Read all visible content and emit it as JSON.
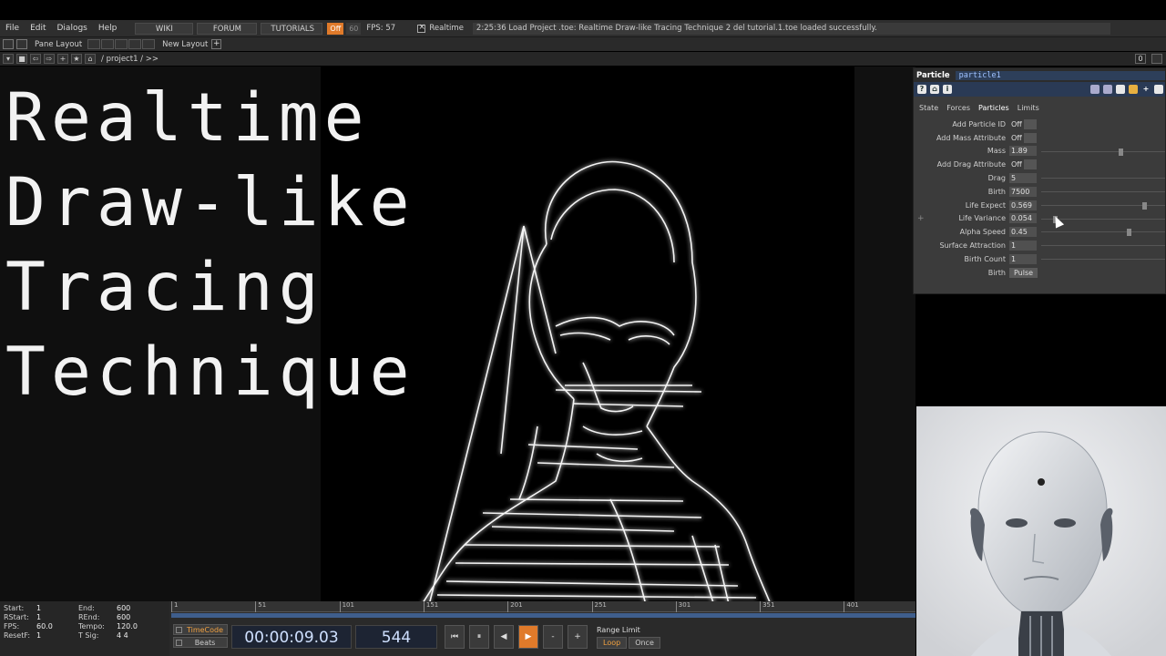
{
  "menu": {
    "items": [
      "File",
      "Edit",
      "Dialogs",
      "Help"
    ],
    "wiki": "WIKI",
    "forum": "FORUM",
    "tutorials": "TUTORIALS",
    "realtime_on": "Off",
    "realtime_rate": "60",
    "fps": "FPS:  57",
    "realtime_label": "Realtime",
    "status": "2:25:36 Load Project .toe: Realtime Draw-like Tracing Technique 2 del tutorial.1.toe loaded successfully."
  },
  "layout_bar": {
    "pane_layout": "Pane Layout",
    "new_layout": "New Layout",
    "plus": "+"
  },
  "path_bar": {
    "path": "/ project1 / >>",
    "right_value": "0"
  },
  "title": {
    "line1": "Realtime",
    "line2": "Draw-like",
    "line3": "Tracing",
    "line4": "Technique"
  },
  "params": {
    "type": "Particle",
    "name": "particle1",
    "toolbar": [
      "?",
      "⌂",
      "i"
    ],
    "tabs": [
      "State",
      "Forces",
      "Particles",
      "Limits"
    ],
    "active_tab": "Particles",
    "rows": [
      {
        "label": "Add Particle ID",
        "value": "Off",
        "kind": "toggle"
      },
      {
        "label": "Add Mass Attribute",
        "value": "Off",
        "kind": "toggle"
      },
      {
        "label": "Mass",
        "value": "1.89",
        "kind": "slider",
        "level": 0.65
      },
      {
        "label": "Add Drag Attribute",
        "value": "Off",
        "kind": "toggle"
      },
      {
        "label": "Drag",
        "value": "5",
        "kind": "plain"
      },
      {
        "label": "Birth",
        "value": "7500",
        "kind": "plain"
      },
      {
        "label": "Life Expect",
        "value": "0.569",
        "kind": "slider",
        "level": 0.85
      },
      {
        "label": "Life Variance",
        "value": "0.054",
        "kind": "slider",
        "level": 0.1
      },
      {
        "label": "Alpha Speed",
        "value": "0.45",
        "kind": "slider",
        "level": 0.72
      },
      {
        "label": "Surface Attraction",
        "value": "1",
        "kind": "plain"
      },
      {
        "label": "Birth Count",
        "value": "1",
        "kind": "plain"
      },
      {
        "label": "Birth",
        "value": "Pulse",
        "kind": "pulse"
      }
    ],
    "plus": "+"
  },
  "stats": {
    "start_k": "Start:",
    "start_v": "1",
    "end_k": "End:",
    "end_v": "600",
    "rstart_k": "RStart:",
    "rstart_v": "1",
    "rend_k": "REnd:",
    "rend_v": "600",
    "fps_k": "FPS:",
    "fps_v": "60.0",
    "tempo_k": "Tempo:",
    "tempo_v": "120.0",
    "resetf_k": "ResetF:",
    "resetf_v": "1",
    "tsig_k": "T Sig:",
    "tsig_v": "4   4"
  },
  "ruler": [
    "1",
    "51",
    "101",
    "151",
    "201",
    "251",
    "301",
    "351",
    "401"
  ],
  "timeline": {
    "timecode_label": "TimeCode",
    "beats_label": "Beats",
    "timecode": "00:00:09.03",
    "frame": "544",
    "buttons": [
      "⏮",
      "⏸",
      "◀",
      "▶",
      "-",
      "+"
    ],
    "range_limit": "Range Limit",
    "loop": "Loop",
    "once": "Once"
  },
  "colors": {
    "accent": "#e07a2a",
    "timebar": "#3f5e8c",
    "param_name": "#9fc2ff"
  }
}
